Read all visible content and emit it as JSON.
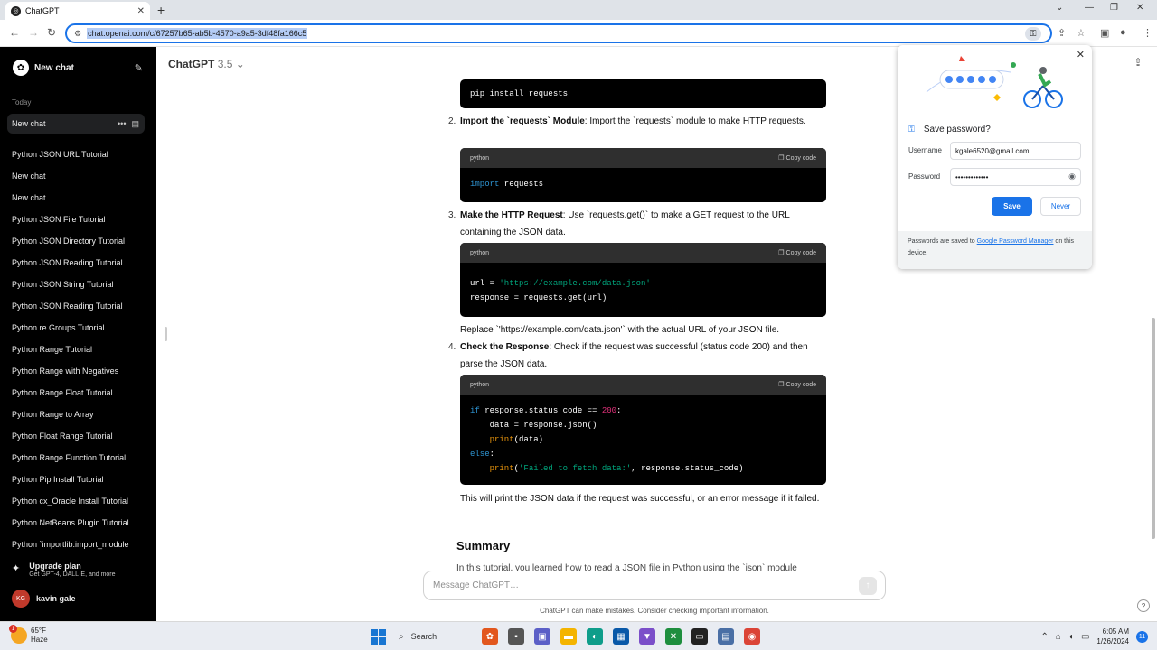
{
  "browser": {
    "tab_title": "ChatGPT",
    "url": "chat.openai.com/c/67257b65-ab5b-4570-a9a5-3df48fa166c5"
  },
  "sidebar": {
    "new_chat_label": "New chat",
    "section_label": "Today",
    "active_chat": "New chat",
    "chats": [
      "Python JSON URL Tutorial",
      "New chat",
      "New chat",
      "Python JSON File Tutorial",
      "Python JSON Directory Tutorial",
      "Python JSON Reading Tutorial",
      "Python JSON String Tutorial",
      "Python JSON Reading Tutorial",
      "Python re Groups Tutorial",
      "Python Range Tutorial",
      "Python Range with Negatives",
      "Python Range Float Tutorial",
      "Python Range to Array",
      "Python Float Range Tutorial",
      "Python Range Function Tutorial",
      "Python Pip Install Tutorial",
      "Python cx_Oracle Install Tutorial",
      "Python NetBeans Plugin Tutorial",
      "Python `importlib.import_module"
    ],
    "upgrade_title": "Upgrade plan",
    "upgrade_sub": "Get GPT-4, DALL·E, and more",
    "user_initials": "KG",
    "user_name": "kavin gale"
  },
  "header": {
    "model_name": "ChatGPT",
    "model_version": "3.5"
  },
  "content": {
    "code0": "pip install requests",
    "step2_num": "2.",
    "step2_title": "Import the `requests` Module",
    "step2_text": ": Import the `requests` module to make HTTP requests.",
    "lang": "python",
    "copy_label": "Copy code",
    "step3_num": "3.",
    "step3_title": "Make the HTTP Request",
    "step3_text": ": Use `requests.get()` to make a GET request to the URL containing the JSON data.",
    "replace_text": "Replace `'https://example.com/data.json'` with the actual URL of your JSON file.",
    "step4_num": "4.",
    "step4_title": "Check the Response",
    "step4_text": ": Check if the request was successful (status code 200) and then parse the JSON data.",
    "after_text": "This will print the JSON data if the request was successful, or an error message if it failed.",
    "summary_heading": "Summary",
    "summary_cut": "In this tutorial, you learned how to read a JSON file in Python using the `json` module"
  },
  "composer": {
    "placeholder": "Message ChatGPT…",
    "disclaimer": "ChatGPT can make mistakes. Consider checking important information."
  },
  "password_popup": {
    "title": "Save password?",
    "username_label": "Username",
    "username_value": "kgale6520@gmail.com",
    "password_label": "Password",
    "password_value": "•••••••••••••",
    "save_label": "Save",
    "never_label": "Never",
    "footer_pre": "Passwords are saved to ",
    "footer_link": "Google Password Manager",
    "footer_post": " on this device."
  },
  "taskbar": {
    "temp": "65°F",
    "condition": "Haze",
    "weather_badge": "1",
    "search_label": "Search",
    "time": "6:05 AM",
    "date": "1/26/2024",
    "notif_count": "11"
  }
}
